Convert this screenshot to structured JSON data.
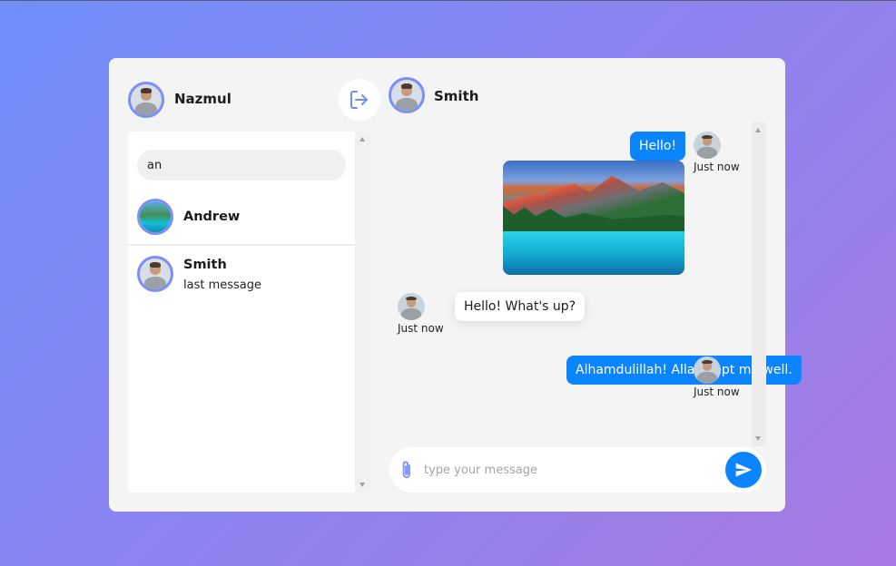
{
  "current_user": {
    "name": "Nazmul"
  },
  "sidebar": {
    "search": {
      "value": "an",
      "placeholder": ""
    },
    "contacts": [
      {
        "name": "Andrew",
        "last_message": ""
      },
      {
        "name": "Smith",
        "last_message": "last message"
      }
    ]
  },
  "chat": {
    "contact_name": "Smith",
    "messages": [
      {
        "direction": "outgoing",
        "text": "Hello!",
        "time": "Just now"
      },
      {
        "direction": "outgoing",
        "type": "image",
        "time": ""
      },
      {
        "direction": "incoming",
        "text": "Hello! What's up?",
        "time": "Just now"
      },
      {
        "direction": "outgoing",
        "text": "Alhamdulillah! Allah kept me well.",
        "time": "Just now"
      }
    ],
    "composer": {
      "placeholder": "type your message",
      "value": ""
    }
  },
  "icons": {
    "logout": "logout-icon",
    "attach": "paperclip-icon",
    "send": "send-icon"
  },
  "colors": {
    "accent": "#0b84ff",
    "avatar_ring": "#7b8ff8",
    "logout_icon": "#6f8ef5",
    "background_start": "#6f8ffb",
    "background_end": "#a77ae0"
  }
}
